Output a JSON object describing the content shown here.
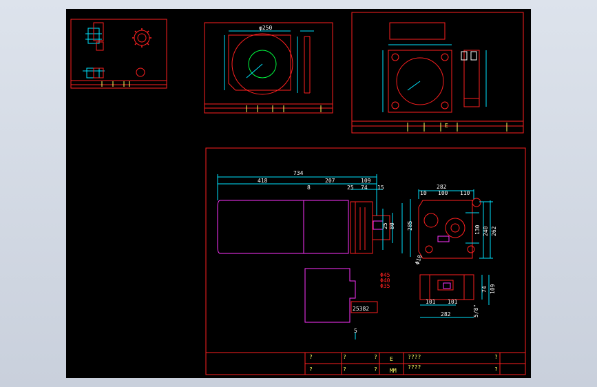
{
  "main_view": {
    "dims_top": [
      "734",
      "418",
      "207",
      "109",
      "8",
      "25",
      "74",
      "15"
    ],
    "dims_mid": [
      "80",
      "25",
      "285"
    ],
    "shaft_labels": [
      "Φ45",
      "Φ40",
      "Φ35"
    ],
    "dim_bottom": "25382",
    "dim_small": "5",
    "side_dims_top": [
      "282",
      "10",
      "100",
      "110"
    ],
    "side_dims_right": [
      "240",
      "262",
      "130"
    ],
    "side_dim_hole": "Φ18",
    "bottom_dims": [
      "74",
      "109",
      "101",
      "101",
      "282",
      "5/8\""
    ]
  },
  "title_block": {
    "marks": [
      "?",
      "?",
      "?",
      "?",
      "?",
      "?",
      "?",
      "?"
    ],
    "code": "E",
    "unit": "MM",
    "text1": "????",
    "text2": "????"
  },
  "small_sheets": {
    "sheet2_label": "φ250",
    "sheet3_label": "E"
  }
}
